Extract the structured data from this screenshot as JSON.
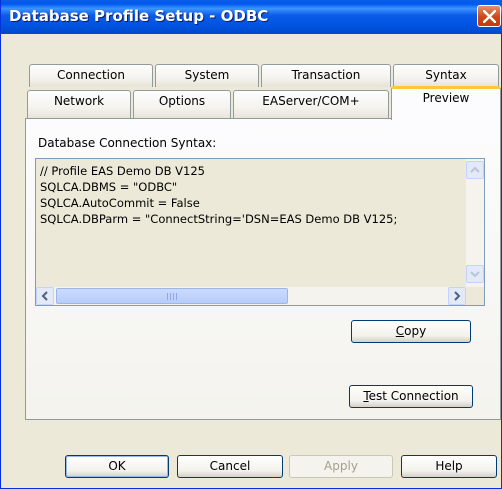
{
  "window": {
    "title": "Database Profile Setup - ODBC"
  },
  "tabs": {
    "back_row": [
      {
        "label": "Connection"
      },
      {
        "label": "System"
      },
      {
        "label": "Transaction"
      },
      {
        "label": "Syntax"
      }
    ],
    "front_row": [
      {
        "label": "Network"
      },
      {
        "label": "Options"
      },
      {
        "label": "EAServer/COM+"
      },
      {
        "label": "Preview",
        "active": true
      }
    ]
  },
  "preview": {
    "label": "Database Connection Syntax:",
    "lines": [
      "// Profile EAS Demo DB V125",
      "SQLCA.DBMS = \"ODBC\"",
      "SQLCA.AutoCommit = False",
      "SQLCA.DBParm = \"ConnectString='DSN=EAS Demo DB V125;"
    ],
    "copy_button": {
      "accel": "C",
      "rest": "opy"
    },
    "test_button": {
      "accel": "T",
      "rest": "est Connection"
    }
  },
  "footer": {
    "ok": "OK",
    "cancel": "Cancel",
    "apply": "Apply",
    "help": "Help"
  },
  "colors": {
    "titlebar": "#0054E3",
    "dialog_bg": "#ECE9D8",
    "active_tab_accent": "#FFC83C",
    "close_button": "#D2451A"
  },
  "icons": {
    "close": "close-icon",
    "scroll_up": "arrow-up-icon",
    "scroll_down": "arrow-down-icon",
    "scroll_left": "arrow-left-icon",
    "scroll_right": "arrow-right-icon"
  }
}
